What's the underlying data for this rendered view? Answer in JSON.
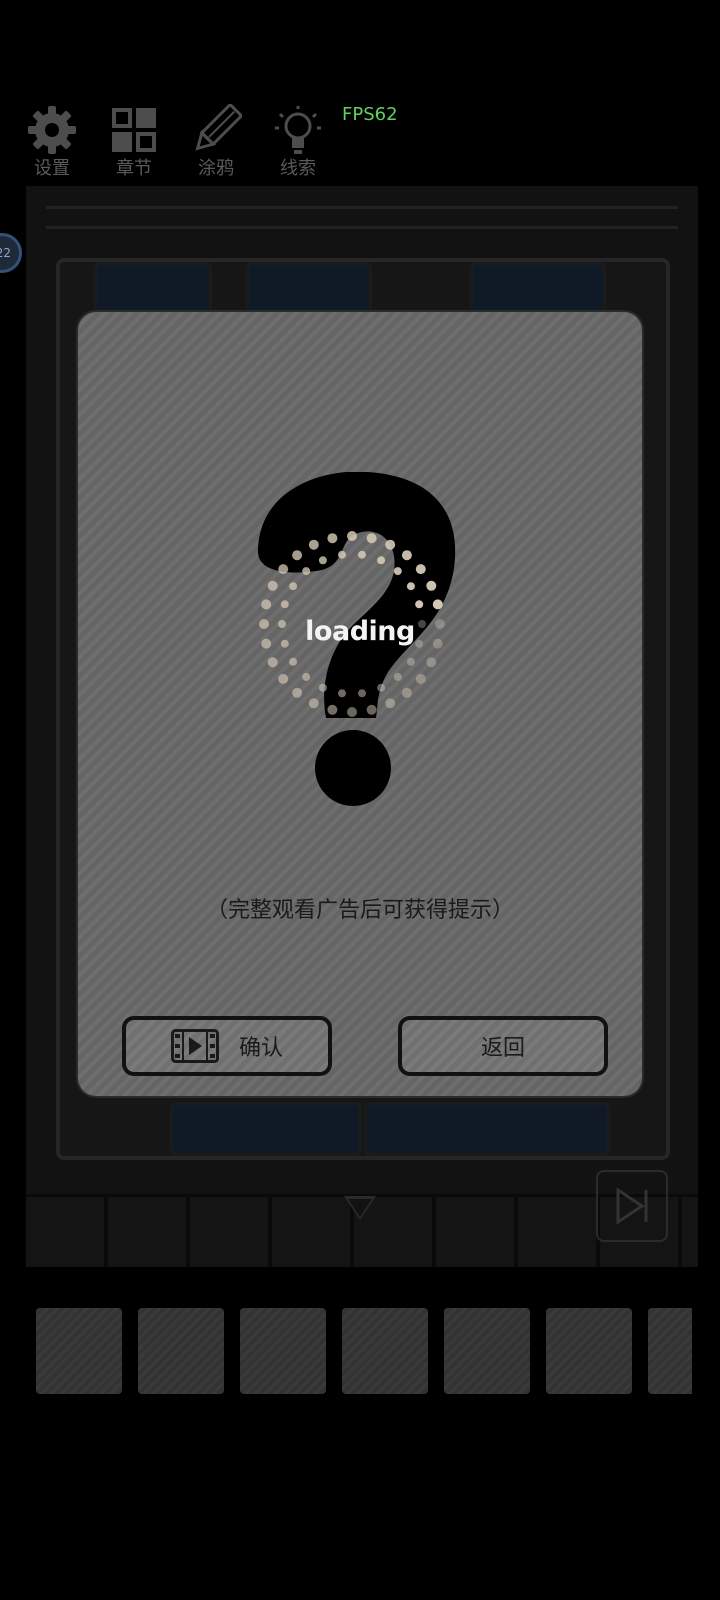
{
  "toolbar": {
    "items": [
      {
        "label": "设置",
        "icon": "gear-icon"
      },
      {
        "label": "章节",
        "icon": "chapters-grid-icon"
      },
      {
        "label": "涂鸦",
        "icon": "pencil-icon"
      },
      {
        "label": "线索",
        "icon": "lightbulb-icon"
      }
    ]
  },
  "fps": "FPS62",
  "level_badge": "22",
  "dialog": {
    "loading": "loading",
    "message": "（完整观看广告后可获得提示）",
    "confirm_label": "确认",
    "back_label": "返回",
    "confirm_icon": "video-film-icon",
    "hint_icon": "question-mark-icon"
  },
  "scene": {
    "down_arrow_icon": "down-arrow-icon",
    "skip_icon": "skip-forward-icon"
  },
  "inventory": {
    "slot_count": 7
  },
  "colors": {
    "fps": "#5fd35f",
    "dialog_bg": "#6a6a6a",
    "loading_dots": "#d8cbb8"
  }
}
